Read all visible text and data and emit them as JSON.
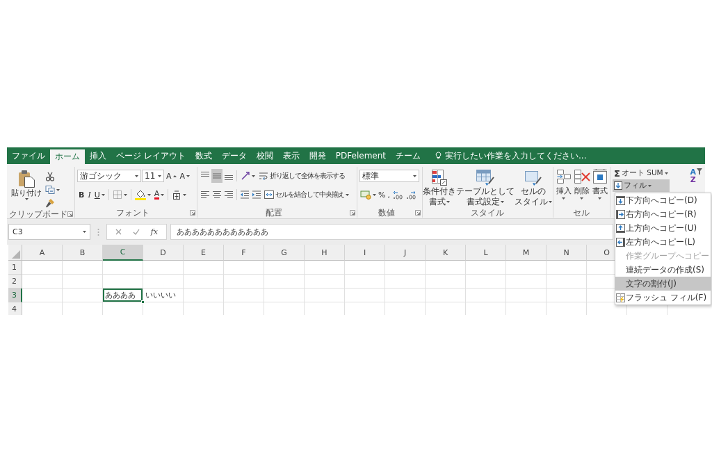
{
  "tabs": [
    {
      "label": "ファイル",
      "selected": false
    },
    {
      "label": "ホーム",
      "selected": true
    },
    {
      "label": "挿入",
      "selected": false
    },
    {
      "label": "ページ レイアウト",
      "selected": false
    },
    {
      "label": "数式",
      "selected": false
    },
    {
      "label": "データ",
      "selected": false
    },
    {
      "label": "校閲",
      "selected": false
    },
    {
      "label": "表示",
      "selected": false
    },
    {
      "label": "開発",
      "selected": false
    },
    {
      "label": "PDFelement",
      "selected": false
    },
    {
      "label": "チーム",
      "selected": false
    }
  ],
  "tell_me": {
    "placeholder": "実行したい作業を入力してください..."
  },
  "ribbon": {
    "clipboard": {
      "paste_label": "貼り付け",
      "group_label": "クリップボード"
    },
    "font": {
      "font_name": "游ゴシック",
      "font_size": "11",
      "grow_label": "A",
      "shrink_label": "A",
      "style_buttons": [
        {
          "label": "B",
          "kind": "bold"
        },
        {
          "label": "I",
          "kind": "italic"
        },
        {
          "label": "U",
          "kind": "underline"
        }
      ],
      "font_color_label": "A",
      "group_label": "フォント"
    },
    "alignment": {
      "vertical_buttons": [
        {
          "kind": "top",
          "selected": false
        },
        {
          "kind": "middle",
          "selected": true
        },
        {
          "kind": "bottom",
          "selected": false
        }
      ],
      "horizontal_buttons": [
        {
          "kind": "left",
          "selected": false
        },
        {
          "kind": "center",
          "selected": false
        },
        {
          "kind": "right",
          "selected": false
        }
      ],
      "wrap_label": "折り返して全体を表示する",
      "merge_label": "セルを結合して中央揃え",
      "group_label": "配置"
    },
    "number": {
      "format": "標準",
      "percent_label": "%",
      "comma_label": ",",
      "group_label": "数値"
    },
    "styles": {
      "buttons": [
        {
          "kind": "conditional",
          "lines": [
            "条件付き",
            "書式"
          ]
        },
        {
          "kind": "table",
          "lines": [
            "テーブルとして",
            "書式設定"
          ]
        },
        {
          "kind": "cell",
          "lines": [
            "セルの",
            "スタイル"
          ]
        }
      ],
      "group_label": "スタイル"
    },
    "cells": {
      "buttons": [
        {
          "kind": "insert",
          "label": "挿入"
        },
        {
          "kind": "delete",
          "label": "削除"
        },
        {
          "kind": "format",
          "label": "書式"
        }
      ],
      "group_label": "セル"
    },
    "editing": {
      "autosum": {
        "symbol": "Σ",
        "label": "オート SUM"
      },
      "fill": {
        "label": "フィル",
        "expanded": true,
        "menu": [
          {
            "kind": "down",
            "label": "下方向へコピー(D)",
            "disabled": false,
            "selected": false
          },
          {
            "kind": "right",
            "label": "右方向へコピー(R)",
            "disabled": false,
            "selected": false
          },
          {
            "kind": "up",
            "label": "上方向へコピー(U)",
            "disabled": false,
            "selected": false
          },
          {
            "kind": "left",
            "label": "左方向へコピー(L)",
            "disabled": false,
            "selected": false
          },
          {
            "kind": "plain",
            "label": "作業グループへコピー",
            "disabled": true,
            "selected": false
          },
          {
            "kind": "plain",
            "label": "連続データの作成(S)",
            "disabled": false,
            "selected": false
          },
          {
            "kind": "plain",
            "label": "文字の割付(J)",
            "disabled": false,
            "selected": true
          },
          {
            "kind": "flash",
            "label": "フラッシュ フィル(F)",
            "disabled": false,
            "selected": false
          }
        ]
      },
      "sort_labels": [
        "A",
        "Z"
      ]
    }
  },
  "formula_bar": {
    "name_box": "C3",
    "function_label": "fx",
    "formula": "ああああああああああああ"
  },
  "sheet": {
    "columns": [
      {
        "label": "A",
        "selected": false
      },
      {
        "label": "B",
        "selected": false
      },
      {
        "label": "C",
        "selected": true
      },
      {
        "label": "D",
        "selected": false
      },
      {
        "label": "E",
        "selected": false
      },
      {
        "label": "F",
        "selected": false
      },
      {
        "label": "G",
        "selected": false
      },
      {
        "label": "H",
        "selected": false
      },
      {
        "label": "I",
        "selected": false
      },
      {
        "label": "J",
        "selected": false
      },
      {
        "label": "K",
        "selected": false
      },
      {
        "label": "L",
        "selected": false
      },
      {
        "label": "M",
        "selected": false
      },
      {
        "label": "N",
        "selected": false
      },
      {
        "label": "O",
        "selected": false
      }
    ],
    "rows": [
      {
        "label": "1",
        "selected": false
      },
      {
        "label": "2",
        "selected": false
      },
      {
        "label": "3",
        "selected": true,
        "cells": [
          {
            "selected": false
          },
          {
            "selected": false
          },
          {
            "text": "ああああ",
            "selected": true
          },
          {
            "text": "いいいい",
            "selected": false
          }
        ]
      },
      {
        "label": "4",
        "selected": false
      }
    ]
  }
}
